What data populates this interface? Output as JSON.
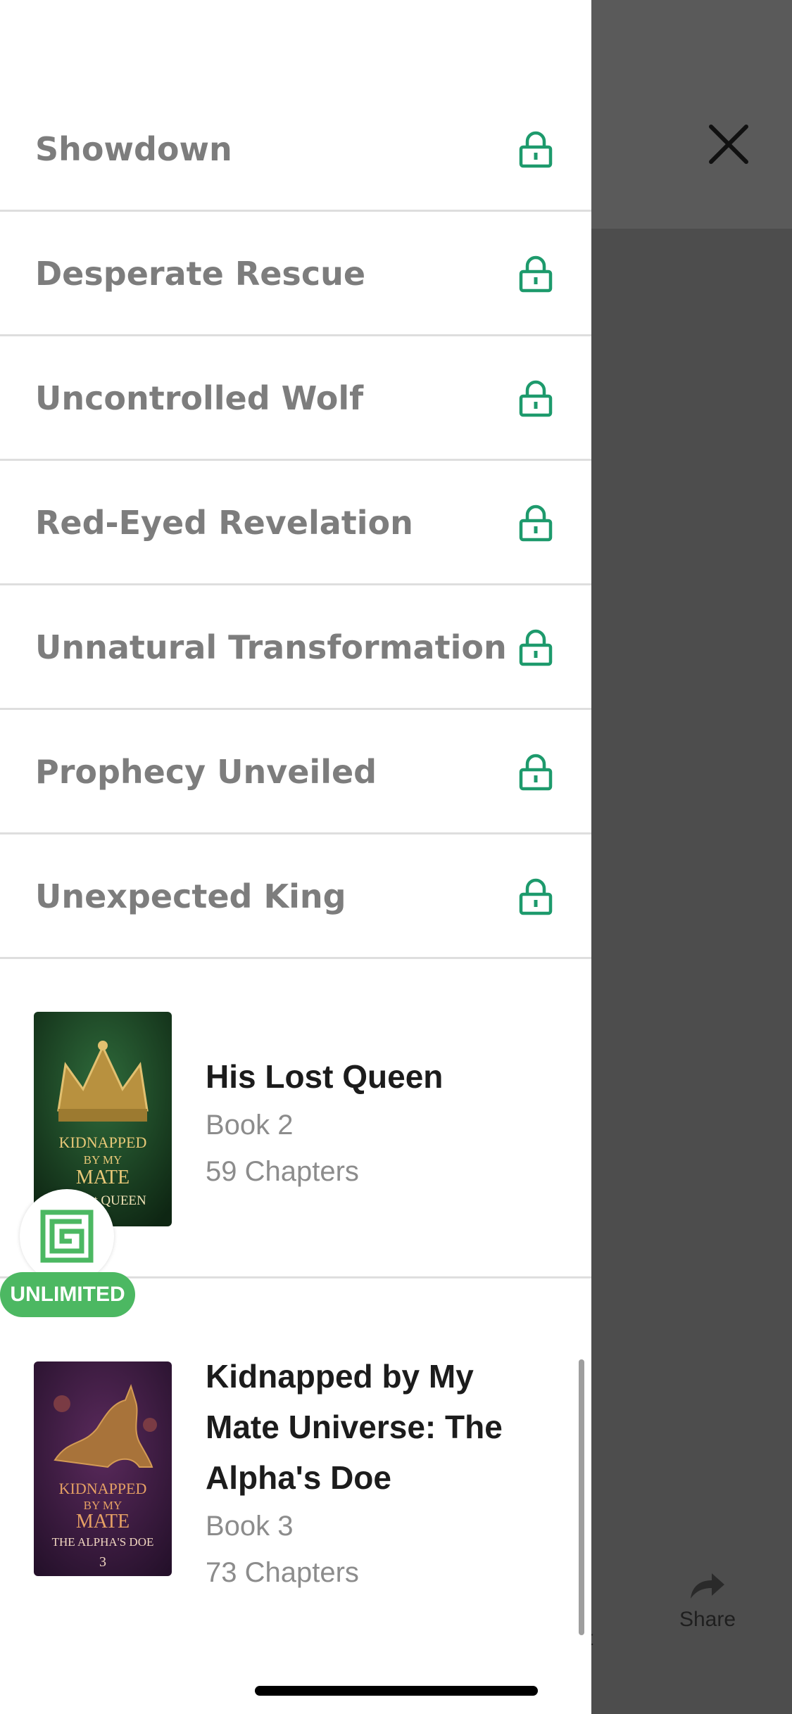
{
  "chapters": [
    {
      "title": "Showdown",
      "locked": true
    },
    {
      "title": "Desperate Rescue",
      "locked": true
    },
    {
      "title": "Uncontrolled Wolf",
      "locked": true
    },
    {
      "title": "Red-Eyed Revelation",
      "locked": true
    },
    {
      "title": "Unnatural Transformation",
      "locked": true
    },
    {
      "title": "Prophecy Unveiled",
      "locked": true
    },
    {
      "title": "Unexpected King",
      "locked": true
    }
  ],
  "books": [
    {
      "title": "His Lost Queen",
      "book": "Book 2",
      "chapters": "59 Chapters",
      "cover_text_1": "KIDNAPPED",
      "cover_text_2": "BY MY",
      "cover_text_3": "MATE",
      "cover_text_4": "his lost QUEEN"
    },
    {
      "title_line1": "Kidnapped by My",
      "title_line2": "Mate Universe: The",
      "title_line3": "Alpha's Doe",
      "book": "Book 3",
      "chapters": "73 Chapters",
      "cover_text_1": "KIDNAPPED",
      "cover_text_2": "BY MY",
      "cover_text_3": "MATE",
      "cover_text_4": "THE ALPHA'S DOE",
      "cover_text_5": "3"
    }
  ],
  "unlimited_badge": "UNLIMITED",
  "share_label": "Share",
  "partial_label": "t",
  "colors": {
    "accent": "#1d9a6c",
    "badge": "#4cb862",
    "overlay": "#4d4d4d"
  }
}
